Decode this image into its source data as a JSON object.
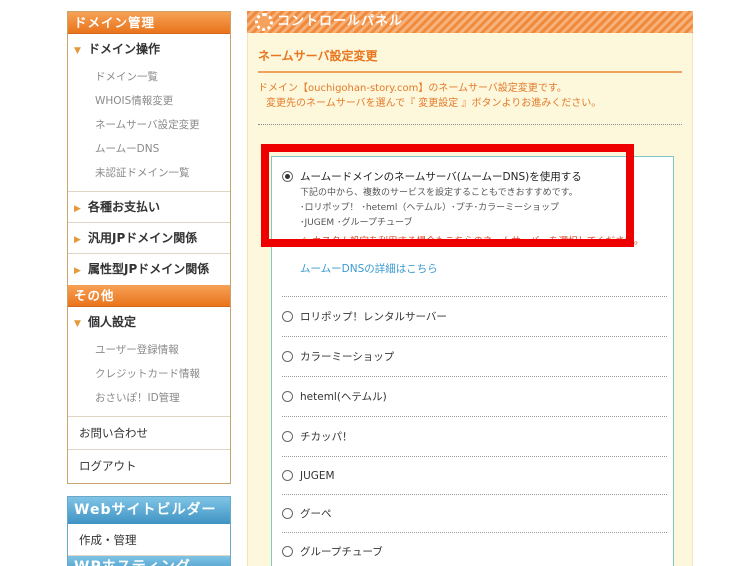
{
  "sidebar": {
    "domain_header": "ドメイン管理",
    "domain_ops": "ドメイン操作",
    "domain_sub": [
      "ドメイン一覧",
      "WHOIS情報変更",
      "ネームサーバ設定変更",
      "ムームーDNS",
      "未認証ドメイン一覧"
    ],
    "payments": "各種お支払い",
    "jp_generic": "汎用JPドメイン関係",
    "jp_attr": "属性型JPドメイン関係",
    "other_header": "その他",
    "personal": "個人設定",
    "personal_sub": [
      "ユーザー登録情報",
      "クレジットカード情報",
      "おさいぽ！ID管理"
    ],
    "contact": "お問い合わせ",
    "logout": "ログアウト",
    "builder_header": "Webサイトビルダー",
    "builder_item": "作成・管理",
    "hosting_header": "WPホスティング"
  },
  "panel": {
    "title": "コントロールパネル",
    "ns_title": "ネームサーバ設定変更",
    "intro_line1": "ドメイン【ouchigohan-story.com】のネームサーバ設定変更です。",
    "intro_line2": "変更先のネームサーバを選んで『 変更設定 』ボタンよりお進みください。",
    "options": {
      "muumuu": {
        "label": "ムームードメインのネームサーバ(ムームーDNS)を使用する",
        "desc1": "下記の中から、複数のサービスを設定することもできおすすめです。",
        "desc2": "･ロリポップ！ ･heteml（ヘテムル）･プチ･カラーミーショップ",
        "desc3": "･JUGEM ･グループチューブ",
        "warning": "カスタム設定を利用する場合もこちらのネームサーバーを選択してください。",
        "detail_link": "ムームーDNSの詳細はこちら"
      },
      "list": [
        "ロリポップ！レンタルサーバー",
        "カラーミーショップ",
        "heteml(ヘテムル)",
        "チカッパ！",
        "JUGEM",
        "グーペ",
        "グループチューブ"
      ]
    }
  },
  "colors": {
    "orange_header": "#e9741c",
    "blue_header": "#3f93c3",
    "highlight": "#ee0000",
    "link": "#3a9ad0"
  }
}
